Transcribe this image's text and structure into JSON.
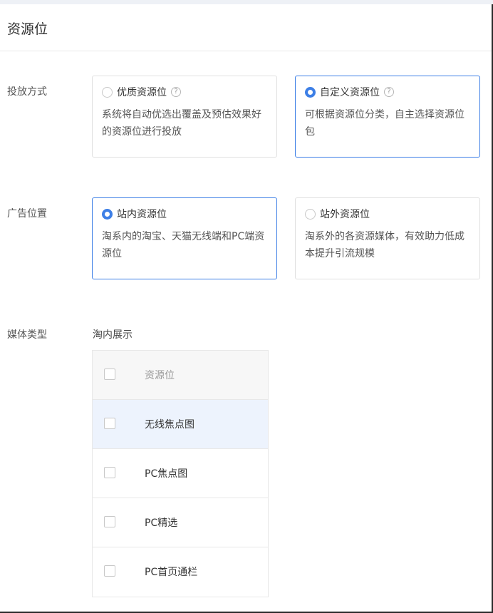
{
  "page": {
    "title": "资源位"
  },
  "placement": {
    "label": "投放方式",
    "options": [
      {
        "title": "优质资源位",
        "desc": "系统将自动优选出覆盖及预估效果好的资源位进行投放",
        "selected": false,
        "has_help": true
      },
      {
        "title": "自定义资源位",
        "desc": "可根据资源位分类，自主选择资源位包",
        "selected": true,
        "has_help": true
      }
    ]
  },
  "ad_position": {
    "label": "广告位置",
    "options": [
      {
        "title": "站内资源位",
        "desc": "淘系内的淘宝、天猫无线端和PC端资源位",
        "selected": true
      },
      {
        "title": "站外资源位",
        "desc": "淘系外的各资源媒体，有效助力低成本提升引流规模",
        "selected": false
      }
    ]
  },
  "media_type": {
    "label": "媒体类型",
    "sub_label": "淘内展示",
    "table": {
      "header": "资源位",
      "rows": [
        "无线焦点图",
        "PC焦点图",
        "PC精选",
        "PC首页通栏"
      ]
    }
  },
  "colors": {
    "accent": "#3d7fe6",
    "hover_row": "#edf3fd",
    "header_row": "#f7f7f7"
  },
  "icons": {
    "help": "question-circle-icon"
  }
}
